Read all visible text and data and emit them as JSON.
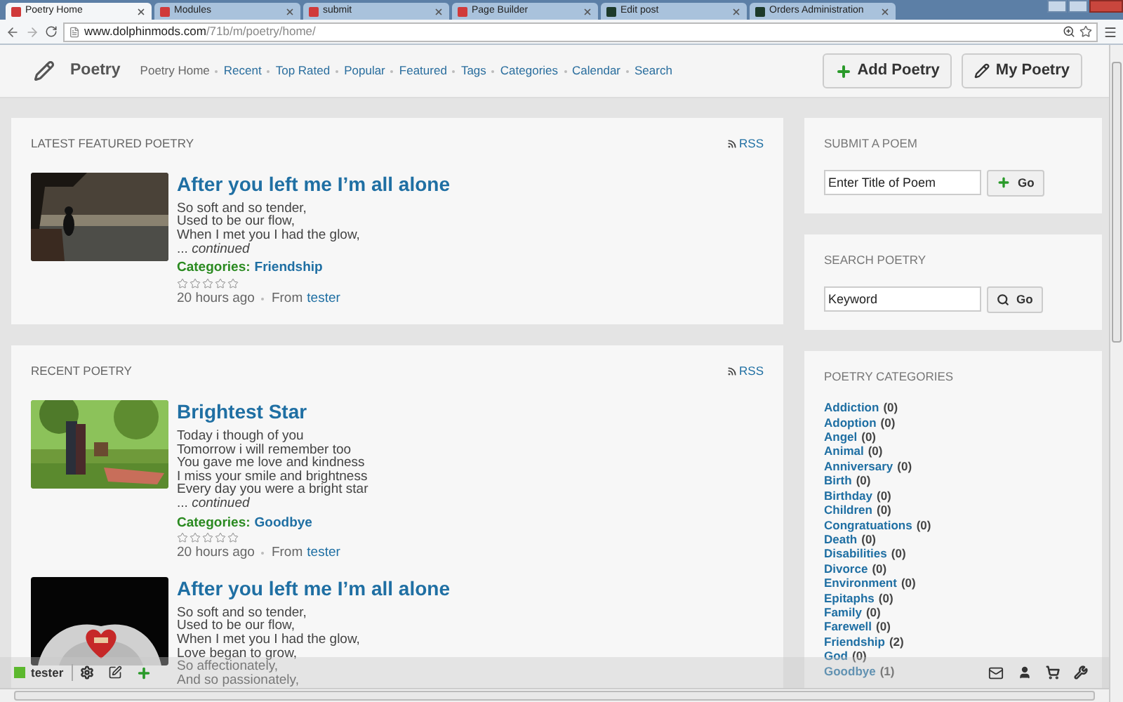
{
  "browser": {
    "tabs": [
      {
        "title": "Poetry Home",
        "selected": true,
        "kind": "site"
      },
      {
        "title": "Modules",
        "selected": false,
        "kind": "site"
      },
      {
        "title": "submit",
        "selected": false,
        "kind": "site"
      },
      {
        "title": "Page Builder",
        "selected": false,
        "kind": "site"
      },
      {
        "title": "Edit post",
        "selected": false,
        "kind": "admin"
      },
      {
        "title": "Orders Administration",
        "selected": false,
        "kind": "admin"
      }
    ],
    "url": {
      "host": "www.dolphinmods.com",
      "path": "/71b/m/poetry/home/"
    }
  },
  "header": {
    "title": "Poetry",
    "nav": [
      "Poetry Home",
      "Recent",
      "Top Rated",
      "Popular",
      "Featured",
      "Tags",
      "Categories",
      "Calendar",
      "Search"
    ],
    "buttons": [
      {
        "label": "Add Poetry",
        "kind": "add"
      },
      {
        "label": "My Poetry",
        "kind": "edit"
      }
    ]
  },
  "sections": [
    {
      "title": "LATEST FEATURED POETRY",
      "rss": "RSS",
      "poems": [
        {
          "title": "After you left me I’m all alone",
          "kind": "picture",
          "lines": [
            "So soft and so tender,",
            "Used to be our flow,",
            "When I met you I had the glow,"
          ],
          "more": "... *continued*",
          "categories_label": "Categories:",
          "category": "Friendship",
          "stars": 0,
          "time": "20 hours ago",
          "from_label": "From",
          "author": "tester"
        }
      ]
    },
    {
      "title": "RECENT POETRY",
      "rss": "RSS",
      "poems": [
        {
          "title": "Brightest Star",
          "kind": "picture",
          "lines": [
            "Today i though of you",
            "Tomorrow i will remember too",
            "You gave me love and kindness",
            "I miss your smile and brightness",
            "Every day you were a bright star"
          ],
          "more": "... *continued*",
          "categories_label": "Categories:",
          "category": "Goodbye",
          "stars": 0,
          "time": "20 hours ago",
          "from_label": "From",
          "author": "tester"
        },
        {
          "title": "After you left me I’m all alone",
          "kind": "picture",
          "lines": [
            "So soft and so tender,",
            "Used to be our flow,",
            "When I met you I had the glow,",
            "Love began to grow,",
            "So affectionately,",
            "And so passionately,"
          ]
        }
      ]
    }
  ],
  "sidebar": {
    "submit": {
      "title": "SUBMIT A POEM",
      "value": "Enter Title of Poem",
      "button": "Go"
    },
    "search": {
      "title": "SEARCH POETRY",
      "value": "Keyword",
      "button": "Go"
    },
    "categories": {
      "title": "POETRY CATEGORIES",
      "items": [
        {
          "name": "Addiction",
          "count": "(0)"
        },
        {
          "name": "Adoption",
          "count": "(0)"
        },
        {
          "name": "Angel",
          "count": "(0)"
        },
        {
          "name": "Animal",
          "count": "(0)"
        },
        {
          "name": "Anniversary",
          "count": "(0)"
        },
        {
          "name": "Birth",
          "count": "(0)"
        },
        {
          "name": "Birthday",
          "count": "(0)"
        },
        {
          "name": "Children",
          "count": "(0)"
        },
        {
          "name": "Congratuations",
          "count": "(0)"
        },
        {
          "name": "Death",
          "count": "(0)"
        },
        {
          "name": "Disabilities",
          "count": "(0)"
        },
        {
          "name": "Divorce",
          "count": "(0)"
        },
        {
          "name": "Environment",
          "count": "(0)"
        },
        {
          "name": "Epitaphs",
          "count": "(0)"
        },
        {
          "name": "Family",
          "count": "(0)"
        },
        {
          "name": "Farewell",
          "count": "(0)"
        },
        {
          "name": "Friendship",
          "count": "(2)"
        },
        {
          "name": "God",
          "count": "(0)"
        },
        {
          "name": "Goodbye",
          "count": "(1)"
        }
      ]
    }
  },
  "toolbar": {
    "user": "tester"
  }
}
